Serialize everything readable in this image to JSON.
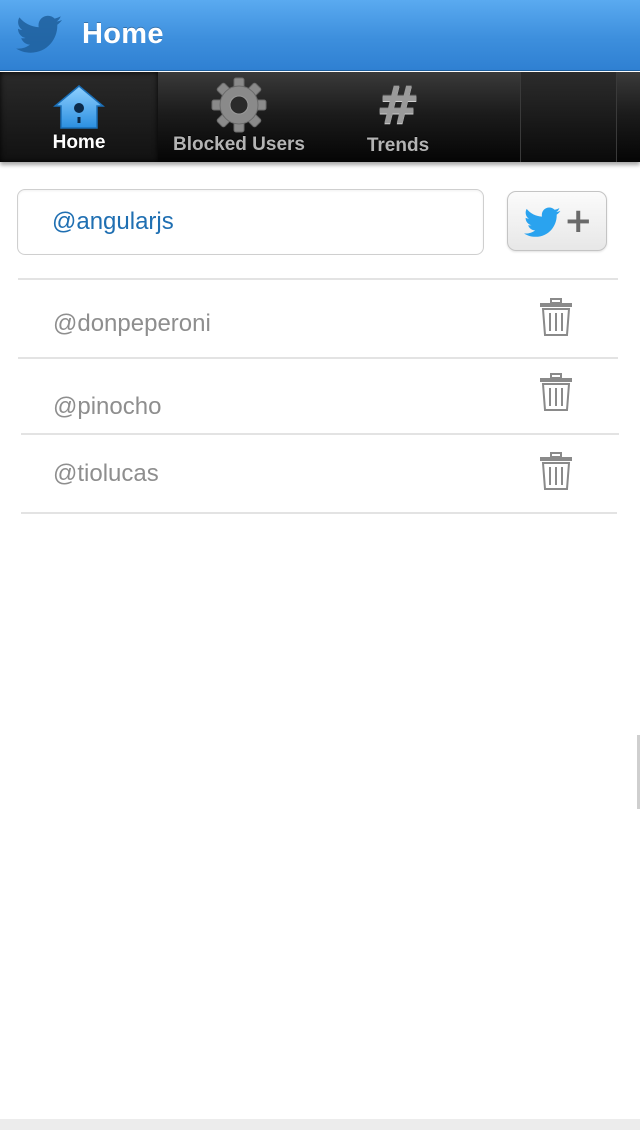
{
  "header": {
    "title": "Home",
    "logo_icon": "twitter-bird-icon"
  },
  "tabs": [
    {
      "label": "Home",
      "icon": "birdhouse-icon",
      "active": true
    },
    {
      "label": "Blocked Users",
      "icon": "gear-icon",
      "active": false
    },
    {
      "label": "Trends",
      "icon": "hashtag-icon",
      "active": false
    }
  ],
  "add_user": {
    "value": "@angularjs",
    "button_icons": [
      "twitter-bird-icon",
      "plus-icon"
    ]
  },
  "blocked_users": [
    {
      "handle": "@donpeperoni",
      "action_icon": "trash-icon"
    },
    {
      "handle": "@pinocho",
      "action_icon": "trash-icon"
    },
    {
      "handle": "@tiolucas",
      "action_icon": "trash-icon"
    }
  ],
  "colors": {
    "header_blue": "#3d8fdd",
    "tabbar_black": "#1c1c1c",
    "input_text": "#1f6fb2",
    "bird_blue": "#2aa3ef",
    "list_text": "#8e8e8e"
  }
}
